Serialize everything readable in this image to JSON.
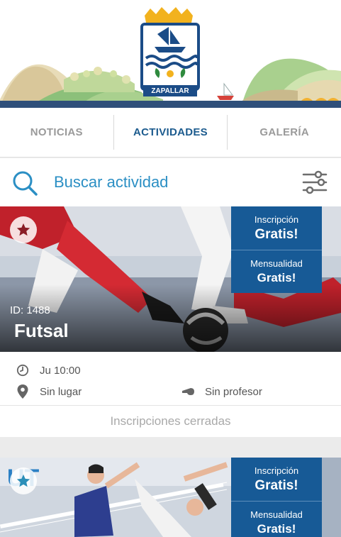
{
  "header": {
    "logo_text": "ZAPALLAR"
  },
  "tabs": [
    {
      "label": "NOTICIAS",
      "active": false
    },
    {
      "label": "ACTIVIDADES",
      "active": true
    },
    {
      "label": "GALERÍA",
      "active": false
    }
  ],
  "search": {
    "placeholder": "Buscar actividad"
  },
  "colors": {
    "primary": "#175a96",
    "accent": "#2b8fc4",
    "tab_active": "#1c5b8e"
  },
  "activities": [
    {
      "id_label": "ID: 1488",
      "title": "Futsal",
      "registration_label": "Inscripción",
      "registration_value": "Gratis!",
      "monthly_label": "Mensualidad",
      "monthly_value": "Gratis!",
      "schedule": "Ju 10:00",
      "place": "Sin lugar",
      "teacher": "Sin profesor",
      "status": "Inscripciones cerradas",
      "favorite_icon": "star-icon"
    },
    {
      "registration_label": "Inscripción",
      "registration_value": "Gratis!",
      "monthly_label": "Mensualidad",
      "monthly_value": "Gratis!",
      "favorite_icon": "star-icon"
    }
  ]
}
